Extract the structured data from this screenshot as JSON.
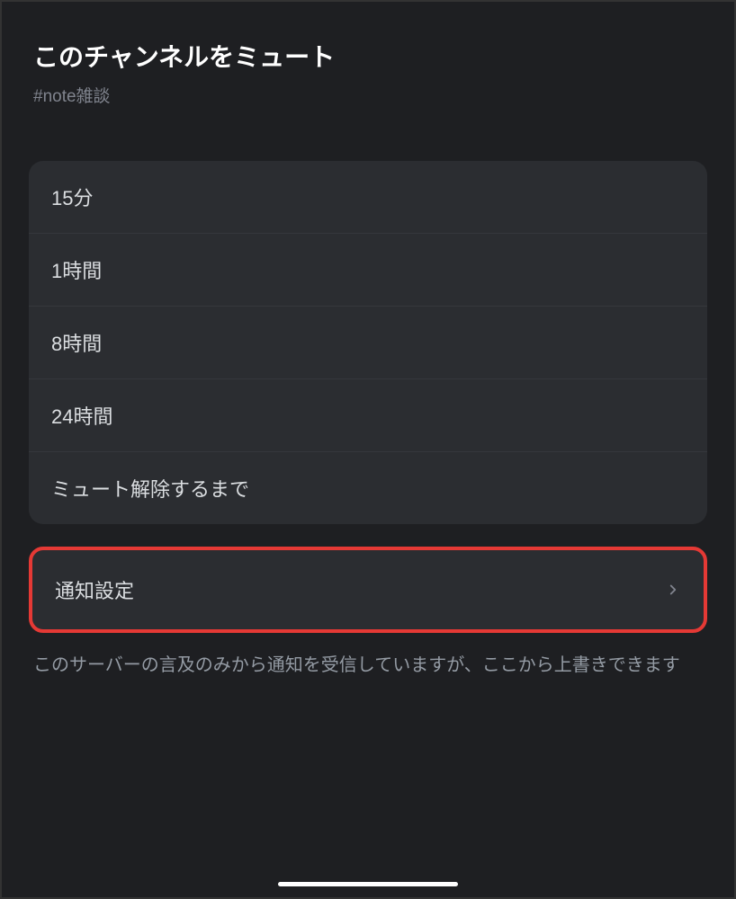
{
  "header": {
    "title": "このチャンネルをミュート",
    "subtitle": "#note雑談"
  },
  "mute_options": [
    {
      "label": "15分"
    },
    {
      "label": "1時間"
    },
    {
      "label": "8時間"
    },
    {
      "label": "24時間"
    },
    {
      "label": "ミュート解除するまで"
    }
  ],
  "notification_settings": {
    "label": "通知設定"
  },
  "description": "このサーバーの言及のみから通知を受信していますが、ここから上書きできます"
}
